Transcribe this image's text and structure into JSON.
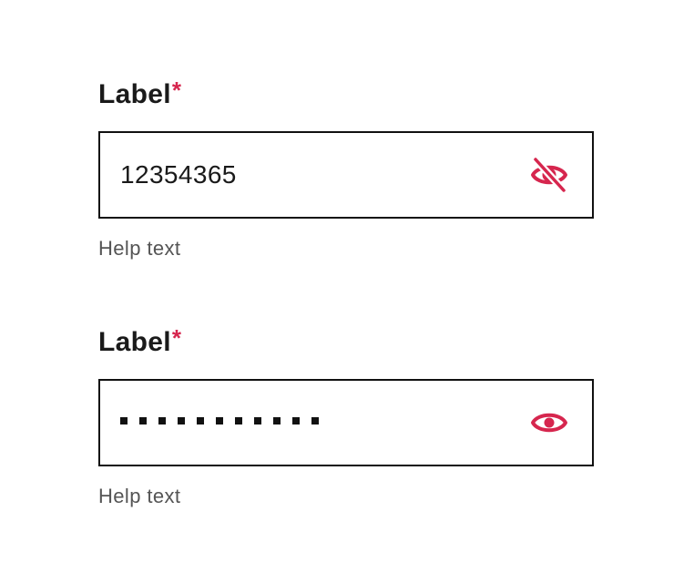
{
  "accent_color": "#d6264e",
  "fields": [
    {
      "label": "Label",
      "required_mark": "*",
      "value": "12354365",
      "masked": false,
      "toggle_icon": "eye-off-icon",
      "help_text": "Help text"
    },
    {
      "label": "Label",
      "required_mark": "*",
      "value_masked_char_count": 11,
      "masked": true,
      "toggle_icon": "eye-icon",
      "help_text": "Help text"
    }
  ]
}
